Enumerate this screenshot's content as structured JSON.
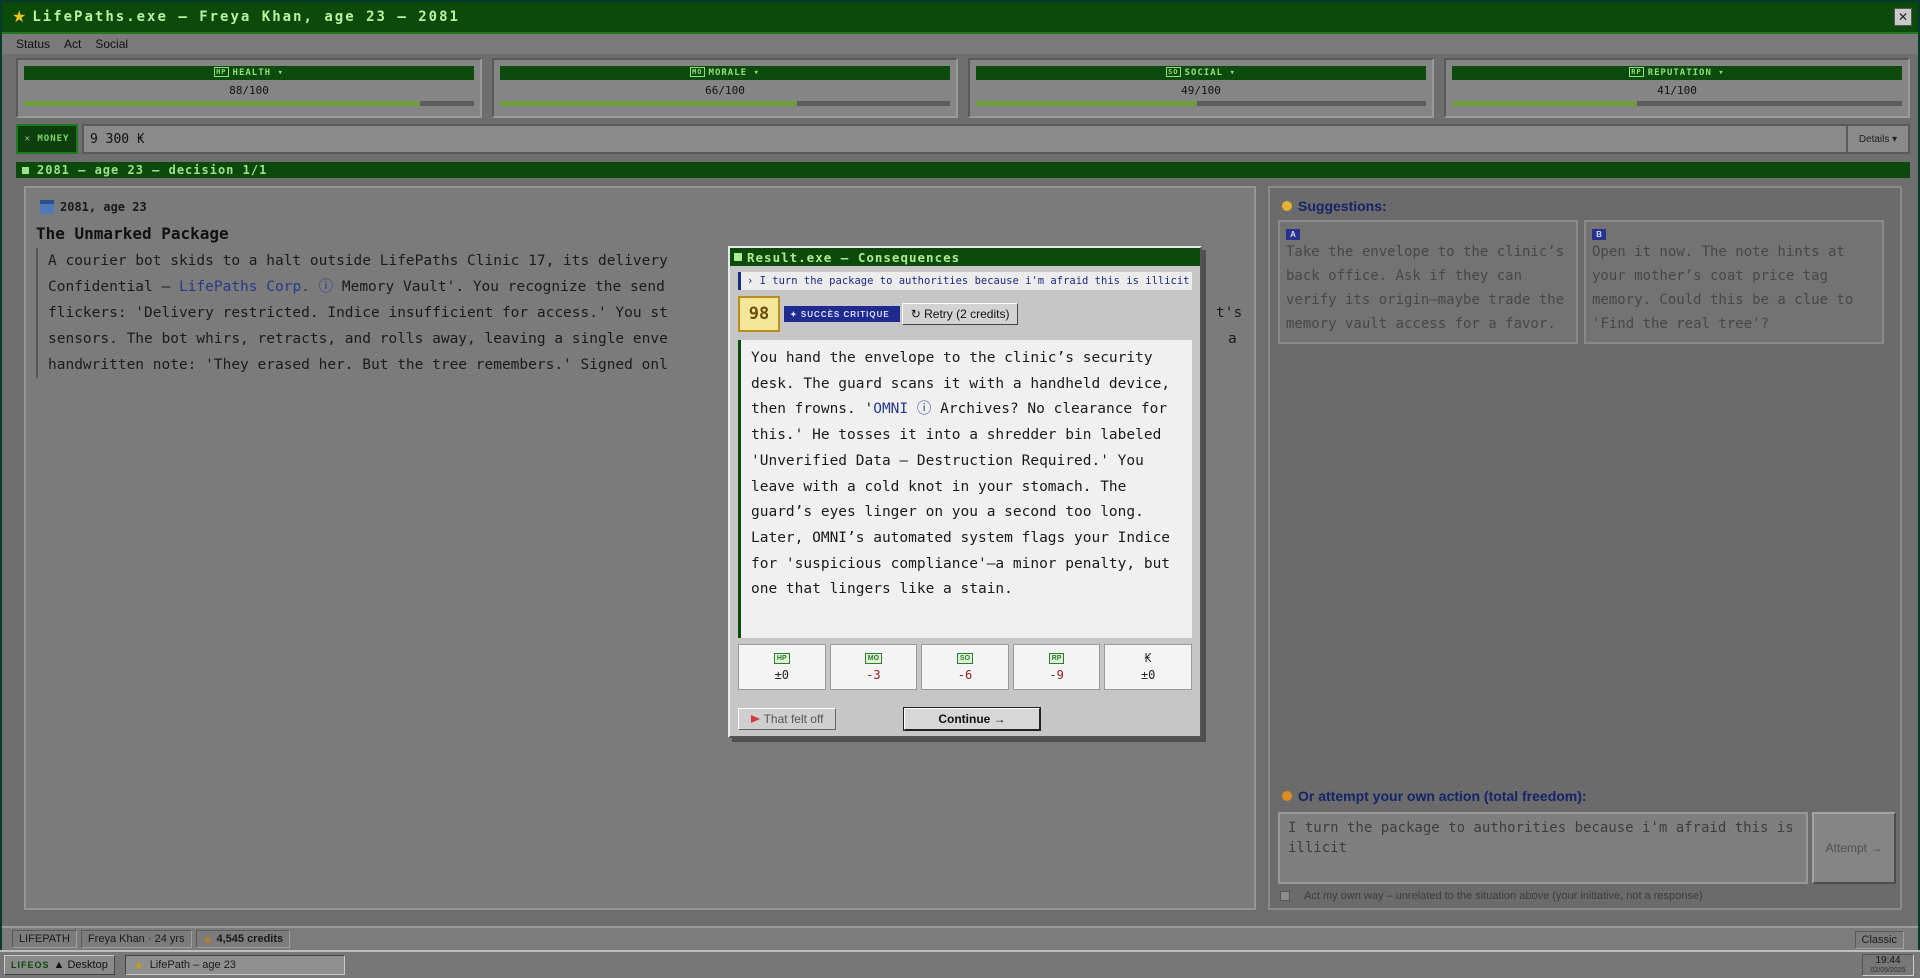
{
  "window": {
    "title": "LifePaths.exe — Freya Khan, age 23 — 2081",
    "close_glyph": "✕"
  },
  "menu": [
    "Status",
    "Act",
    "Social"
  ],
  "stats": [
    {
      "tag": "HP",
      "label": "HEALTH ▾",
      "value": "88/100",
      "level": 0.88
    },
    {
      "tag": "MO",
      "label": "MORALE ▾",
      "value": "66/100",
      "level": 0.66
    },
    {
      "tag": "SO",
      "label": "SOCIAL ▾",
      "value": "49/100",
      "level": 0.49
    },
    {
      "tag": "RP",
      "label": "REPUTATION ▾",
      "value": "41/100",
      "level": 0.41
    }
  ],
  "money": {
    "label": "✕ MONEY",
    "value": "9 300 ₭",
    "details_label": "Details ▾"
  },
  "decision_header": "2081 — age 23 — decision 1/1",
  "story": {
    "date": "2081, age 23",
    "title": "The Unmarked Package",
    "line1_a": "A courier bot skids to a halt outside LifePaths Clinic 17, its delivery",
    "line2_a": "Confidential – ",
    "line2_link": "LifePaths Corp.",
    "line2_info": " ⓘ",
    "line2_b": " Memory Vault'. You recognize the send",
    "line3_a": "flickers: 'Delivery restricted. Indice insufficient for access.' You st",
    "line3_b": "t's",
    "line4_a": "sensors. The bot whirs, retracts, and rolls away, leaving a single enve",
    "line4_b": "a",
    "line5_a": "handwritten note: 'They erased her. But the tree remembers.' Signed onl"
  },
  "suggestions": {
    "title": "Suggestions:",
    "items": [
      {
        "letter": "A",
        "text": "Take the envelope to the clinic’s back office. Ask if they can verify its origin—maybe trade the memory vault access for a favor."
      },
      {
        "letter": "B",
        "text": "Open it now. The note hints at your mother’s coat price tag memory. Could this be a clue to 'Find the real tree'?"
      }
    ]
  },
  "own_action": {
    "title": "Or attempt your own action (total freedom):",
    "input_value": "I turn the package to authorities because i'm afraid this is illicit",
    "attempt_label": "Attempt →",
    "own_way_label": "Act my own way – unrelated to the situation above (your initiative, not a response)"
  },
  "modal": {
    "title": "Result.exe — Consequences",
    "action_line": "› I turn the package to authorities because i'm afraid this is illicit",
    "score": "98",
    "badge": "✦ SUCCÈS CRITIQUE",
    "retry_label": "↻ Retry (2 credits)",
    "result_pre": "You hand the envelope to the clinic’s security desk. The guard scans it with a handheld device, then frowns. '",
    "result_link": "OMNI ⓘ",
    "result_post": " Archives? No clearance for this.' He tosses it into a shredder bin labeled 'Unverified Data – Destruction Required.' You leave with a cold knot in your stomach. The guard’s eyes linger on you a second too long. Later, OMNI’s automated system flags your Indice for 'suspicious compliance'—a minor penalty, but one that lingers like a stain.",
    "deltas": [
      {
        "tag": "HP",
        "value": "±0"
      },
      {
        "tag": "MO",
        "value": "-3"
      },
      {
        "tag": "SO",
        "value": "-6"
      },
      {
        "tag": "RP",
        "value": "-9"
      },
      {
        "tag": "₭",
        "value": "±0"
      }
    ],
    "felt_off_label": "That felt off",
    "continue_label": "Continue →"
  },
  "statusbar": {
    "app": "LIFEPATH",
    "player": "Freya Khan · 24 yrs",
    "credits": "4,545 credits",
    "mode": "Classic"
  },
  "taskbar": {
    "start_brand": "LIFEOS",
    "start_label": "▲ Desktop",
    "task_label": "LifePath – age 23",
    "time": "19:44",
    "date": "02/05/2025"
  },
  "colors": {
    "title_green": "#0c4a0c",
    "accent_blue": "#1f2a8f",
    "negative_red": "#8f1a1a",
    "score_gold": "#f5e79a"
  }
}
